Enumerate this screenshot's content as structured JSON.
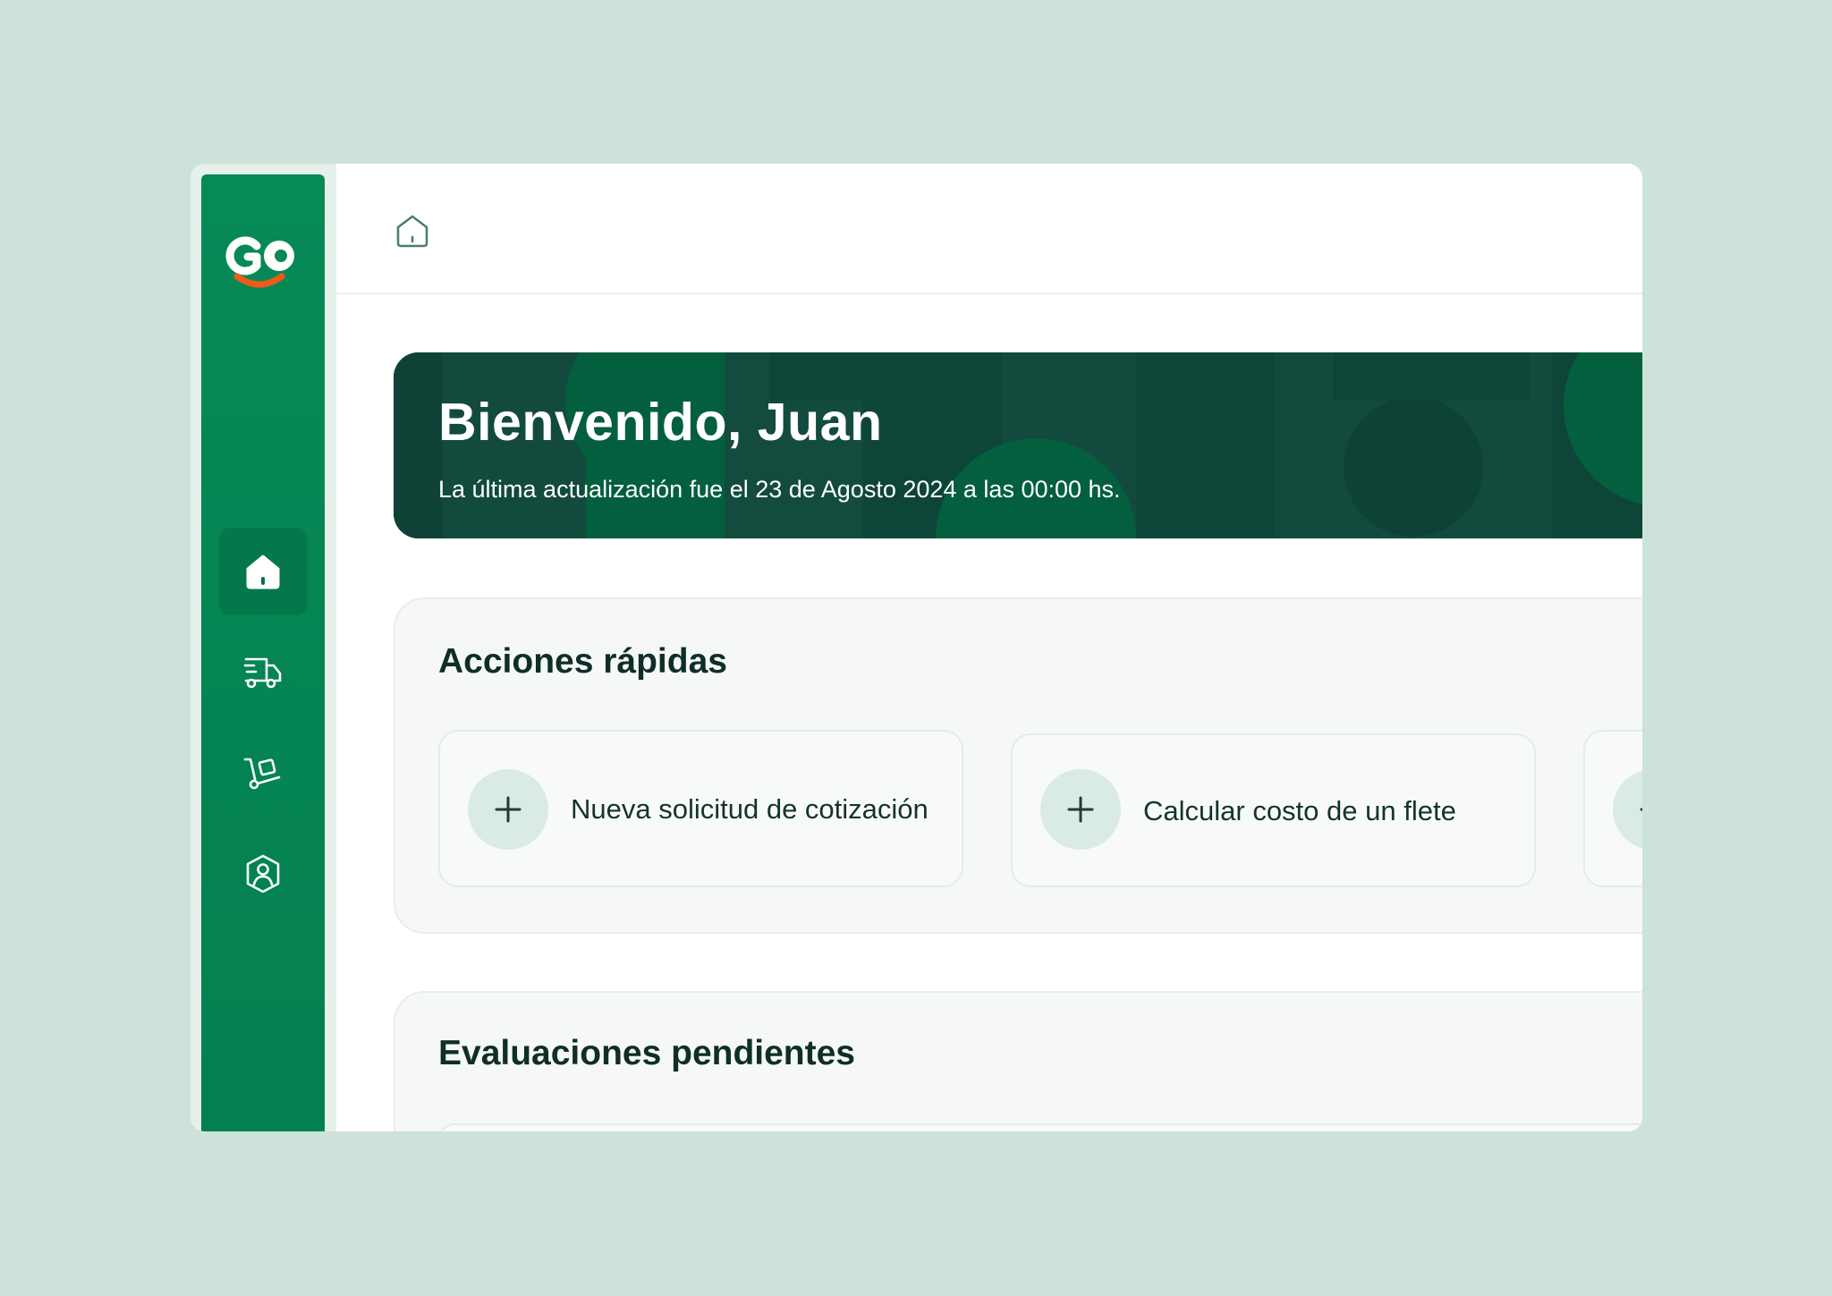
{
  "app": {
    "brand": "GO",
    "colors": {
      "sidebar": "#068a56",
      "hero": "#124a3e",
      "accent_orange": "#f05a1a",
      "background": "#cde2d9"
    }
  },
  "sidebar": {
    "items": [
      {
        "id": "home",
        "icon": "home-icon",
        "active": true
      },
      {
        "id": "shipments",
        "icon": "delivery-truck-icon",
        "active": false
      },
      {
        "id": "cargo",
        "icon": "hand-truck-icon",
        "active": false
      },
      {
        "id": "profile",
        "icon": "user-shield-icon",
        "active": false
      }
    ]
  },
  "header": {
    "breadcrumb_icon": "home-icon"
  },
  "hero": {
    "title": "Bienvenido, Juan",
    "subtitle": "La última actualización fue el 23 de Agosto 2024 a las 00:00 hs."
  },
  "quick_actions": {
    "title": "Acciones rápidas",
    "items": [
      {
        "label": "Nueva solicitud de cotización",
        "icon": "plus-icon"
      },
      {
        "label": "Calcular costo de un flete",
        "icon": "plus-icon"
      },
      {
        "label": "",
        "icon": "plus-icon"
      }
    ]
  },
  "pending_evaluations": {
    "title": "Evaluaciones pendientes"
  }
}
